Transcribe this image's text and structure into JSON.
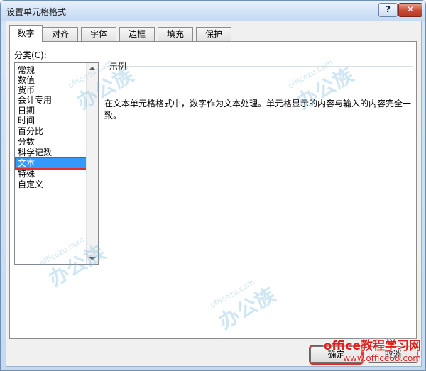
{
  "window": {
    "title": "设置单元格格式",
    "help_label": "?",
    "close_label": "✕"
  },
  "tabs": [
    {
      "label": "数字",
      "active": true
    },
    {
      "label": "对齐",
      "active": false
    },
    {
      "label": "字体",
      "active": false
    },
    {
      "label": "边框",
      "active": false
    },
    {
      "label": "填充",
      "active": false
    },
    {
      "label": "保护",
      "active": false
    }
  ],
  "category": {
    "label": "分类(C):",
    "items": [
      "常规",
      "数值",
      "货币",
      "会计专用",
      "日期",
      "时间",
      "百分比",
      "分数",
      "科学记数",
      "文本",
      "特殊",
      "自定义"
    ],
    "selected_index": 9
  },
  "sample": {
    "label": "示例",
    "value": ""
  },
  "description": "在文本单元格格式中，数字作为文本处理。单元格显示的内容与输入的内容完全一致。",
  "buttons": {
    "ok": "确定",
    "cancel": "取消"
  },
  "watermark": {
    "site": "officezu.com",
    "brand": "办公族"
  },
  "branding": {
    "line1": "office教程学习网",
    "line2": "www.office68.com"
  },
  "colors": {
    "selection": "#3399ff",
    "highlight_outline": "#e32e2e",
    "brand_red": "#e0201c"
  }
}
